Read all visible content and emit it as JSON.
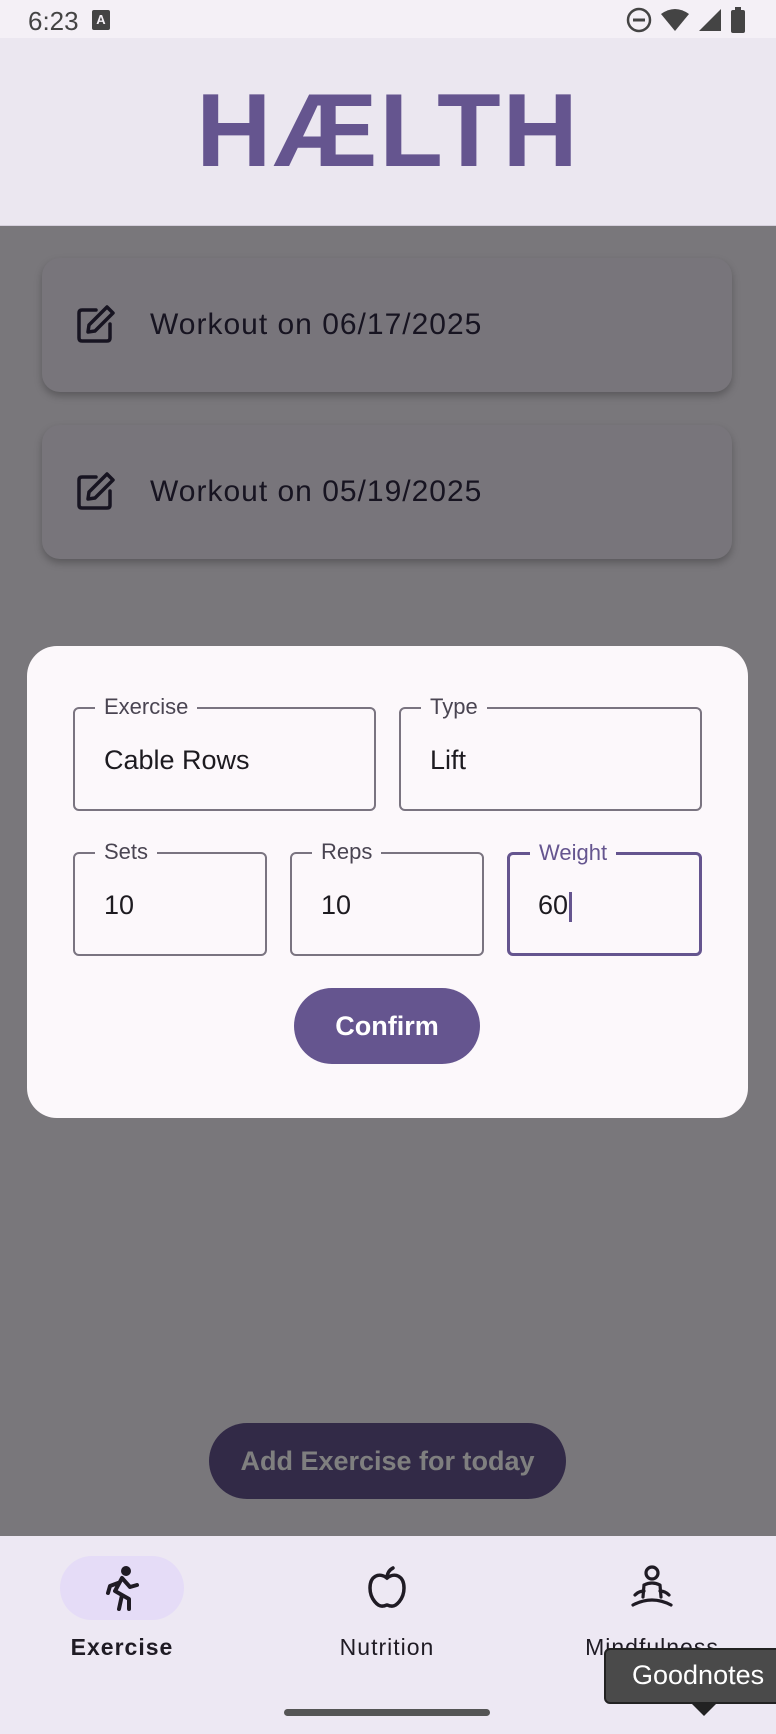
{
  "status_bar": {
    "time": "6:23",
    "notification_icon": "A",
    "icons": [
      "do-not-disturb-icon",
      "wifi-icon",
      "signal-icon",
      "battery-icon"
    ]
  },
  "header": {
    "title": "HÆLTH",
    "title_color": "#65558f"
  },
  "workouts": [
    {
      "label": "Workout on 06/17/2025",
      "icon": "edit-icon"
    },
    {
      "label": "Workout on 05/19/2025",
      "icon": "edit-icon"
    }
  ],
  "add_button": {
    "label": "Add Exercise for today"
  },
  "dialog": {
    "exercise": {
      "label": "Exercise",
      "value": "Cable Rows"
    },
    "type": {
      "label": "Type",
      "value": "Lift"
    },
    "sets": {
      "label": "Sets",
      "value": "10"
    },
    "reps": {
      "label": "Reps",
      "value": "10"
    },
    "weight": {
      "label": "Weight",
      "value": "60"
    },
    "confirm_label": "Confirm"
  },
  "bottom_nav": {
    "items": [
      {
        "label": "Exercise",
        "icon": "run-icon",
        "active": true
      },
      {
        "label": "Nutrition",
        "icon": "apple-icon",
        "active": false
      },
      {
        "label": "Mindfulness",
        "icon": "meditation-icon",
        "active": false
      }
    ]
  },
  "tooltip": {
    "text": "Goodnotes"
  },
  "colors": {
    "accent": "#65558f",
    "scrim": "rgba(0,0,0,0.5)",
    "surface": "#fcf8fb"
  }
}
